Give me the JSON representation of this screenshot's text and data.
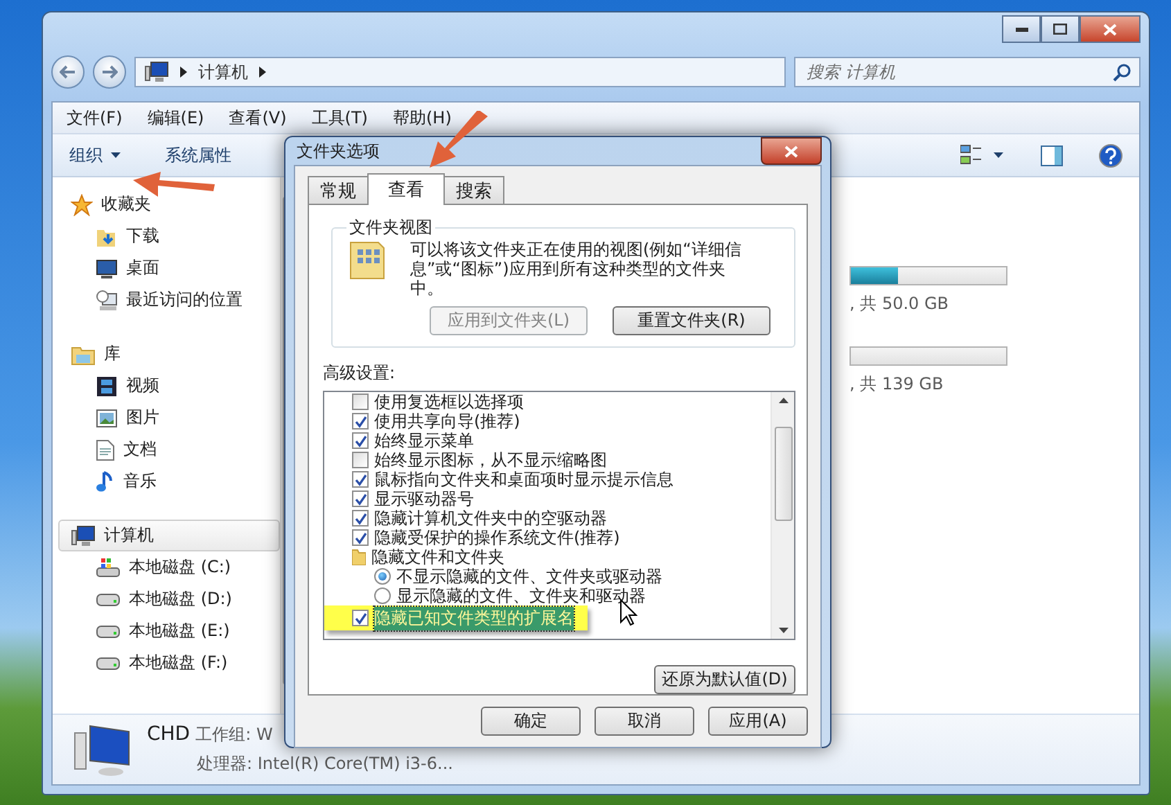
{
  "explorer": {
    "address": "计算机",
    "search": {
      "placeholder": "搜索 计算机"
    },
    "menu": [
      "文件(F)",
      "编辑(E)",
      "查看(V)",
      "工具(T)",
      "帮助(H)"
    ],
    "toolbar": [
      {
        "label": "组织",
        "kind": "dropdown"
      },
      {
        "label": "系统属性",
        "kind": "plain"
      }
    ],
    "sidebar": [
      {
        "label": "收藏夹",
        "kind": "favorites",
        "selected": false,
        "children": [
          {
            "label": "下载",
            "kind": "downloads",
            "selected": false
          },
          {
            "label": "桌面",
            "kind": "desktop",
            "selected": false
          },
          {
            "label": "最近访问的位置",
            "kind": "recent",
            "selected": false
          }
        ]
      },
      {
        "label": "库",
        "kind": "library",
        "selected": false,
        "children": [
          {
            "label": "视频",
            "kind": "video",
            "selected": false
          },
          {
            "label": "图片",
            "kind": "pictures",
            "selected": false
          },
          {
            "label": "文档",
            "kind": "documents",
            "selected": false
          },
          {
            "label": "音乐",
            "kind": "music",
            "selected": false
          }
        ]
      },
      {
        "label": "计算机",
        "kind": "computer",
        "selected": true,
        "children": [
          {
            "label": "本地磁盘 (C:)",
            "kind": "system-drive",
            "selected": false
          },
          {
            "label": "本地磁盘 (D:)",
            "kind": "drive",
            "selected": false
          },
          {
            "label": "本地磁盘 (E:)",
            "kind": "drive",
            "selected": false
          },
          {
            "label": "本地磁盘 (F:)",
            "kind": "drive",
            "selected": false
          }
        ]
      }
    ],
    "drives": [
      {
        "summary": ", 共 50.0 GB",
        "level": 0.3
      },
      {
        "summary": ", 共 139 GB",
        "level": 0
      }
    ],
    "details": {
      "name": "CHD",
      "workgroup": "工作组: W",
      "processor": "处理器: Intel(R) Core(TM) i3-6..."
    }
  },
  "dialog": {
    "title": "文件夹选项",
    "tabs": [
      {
        "label": "常规",
        "selected": false
      },
      {
        "label": "查看",
        "selected": true
      },
      {
        "label": "搜索",
        "selected": false
      }
    ],
    "folder_views": {
      "heading": "文件夹视图",
      "description": "可以将该文件夹正在使用的视图(例如“详细信息”或“图标”)应用到所有这种类型的文件夹中。",
      "buttons": [
        {
          "label": "应用到文件夹(L)",
          "disabled": true
        },
        {
          "label": "重置文件夹(R)",
          "disabled": false
        }
      ]
    },
    "advanced_heading": "高级设置:",
    "advanced": [
      {
        "kind": "checkbox",
        "label": "使用复选框以选择项",
        "checked": false,
        "highlighted": false
      },
      {
        "kind": "checkbox",
        "label": "使用共享向导(推荐)",
        "checked": true,
        "highlighted": false
      },
      {
        "kind": "checkbox",
        "label": "始终显示菜单",
        "checked": true,
        "highlighted": false
      },
      {
        "kind": "checkbox",
        "label": "始终显示图标，从不显示缩略图",
        "checked": false,
        "highlighted": false
      },
      {
        "kind": "checkbox",
        "label": "鼠标指向文件夹和桌面项时显示提示信息",
        "checked": true,
        "highlighted": false
      },
      {
        "kind": "checkbox",
        "label": "显示驱动器号",
        "checked": true,
        "highlighted": false
      },
      {
        "kind": "checkbox",
        "label": "隐藏计算机文件夹中的空驱动器",
        "checked": true,
        "highlighted": false
      },
      {
        "kind": "checkbox",
        "label": "隐藏受保护的操作系统文件(推荐)",
        "checked": true,
        "highlighted": false
      },
      {
        "kind": "folder",
        "label": "隐藏文件和文件夹",
        "children": [
          {
            "kind": "radio",
            "label": "不显示隐藏的文件、文件夹或驱动器",
            "selected": true
          },
          {
            "kind": "radio",
            "label": "显示隐藏的文件、文件夹和驱动器",
            "selected": false
          }
        ]
      },
      {
        "kind": "checkbox",
        "label": "隐藏已知文件类型的扩展名",
        "checked": true,
        "highlighted": true
      }
    ],
    "restore_button": "还原为默认值(D)",
    "buttons": [
      "确定",
      "取消",
      "应用(A)"
    ]
  }
}
